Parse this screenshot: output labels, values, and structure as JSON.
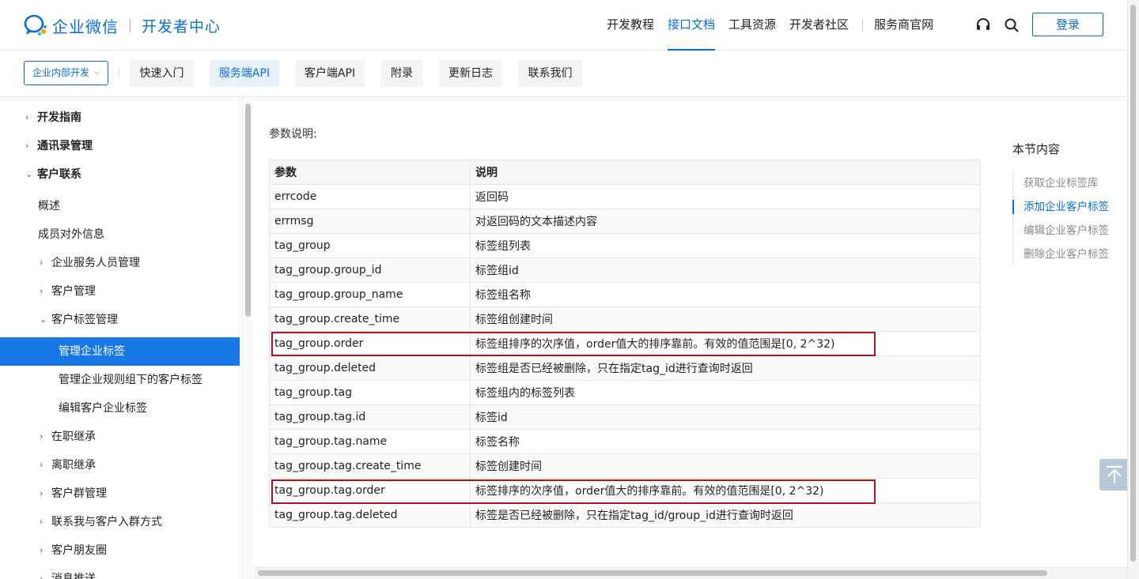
{
  "header": {
    "brand": "企业微信",
    "subtitle": "开发者中心",
    "nav": [
      "开发教程",
      "接口文档",
      "工具资源",
      "开发者社区",
      "服务商官网"
    ],
    "active_nav": 1,
    "login_label": "登录",
    "icons": [
      "headset-icon",
      "search-icon"
    ]
  },
  "subnav": {
    "scope_label": "企业内部开发",
    "tabs": [
      "快速入门",
      "服务端API",
      "客户端API",
      "附录",
      "更新日志",
      "联系我们"
    ],
    "active_tab": 1
  },
  "sidebar": {
    "items": [
      {
        "label": "开发指南",
        "arrow": "›",
        "level": 0
      },
      {
        "label": "通讯录管理",
        "arrow": "›",
        "level": 0
      },
      {
        "label": "客户联系",
        "arrow": "⌄",
        "level": 0
      },
      {
        "label": "概述",
        "arrow": "",
        "level": 1
      },
      {
        "label": "成员对外信息",
        "arrow": "",
        "level": 1
      },
      {
        "label": "企业服务人员管理",
        "arrow": "›",
        "level": 1
      },
      {
        "label": "客户管理",
        "arrow": "›",
        "level": 1
      },
      {
        "label": "客户标签管理",
        "arrow": "⌄",
        "level": 1
      },
      {
        "label": "管理企业标签",
        "arrow": "",
        "level": 2,
        "active": true
      },
      {
        "label": "管理企业规则组下的客户标签",
        "arrow": "",
        "level": 2
      },
      {
        "label": "编辑客户企业标签",
        "arrow": "",
        "level": 2
      },
      {
        "label": "在职继承",
        "arrow": "›",
        "level": 1
      },
      {
        "label": "离职继承",
        "arrow": "›",
        "level": 1
      },
      {
        "label": "客户群管理",
        "arrow": "›",
        "level": 1
      },
      {
        "label": "联系我与客户入群方式",
        "arrow": "›",
        "level": 1
      },
      {
        "label": "客户朋友圈",
        "arrow": "›",
        "level": 1
      },
      {
        "label": "消息推送",
        "arrow": "›",
        "level": 1
      }
    ]
  },
  "main": {
    "section_label": "参数说明:",
    "table": {
      "headers": [
        "参数",
        "说明"
      ],
      "rows": [
        [
          "errcode",
          "返回码"
        ],
        [
          "errmsg",
          "对返回码的文本描述内容"
        ],
        [
          "tag_group",
          "标签组列表"
        ],
        [
          "tag_group.group_id",
          "标签组id"
        ],
        [
          "tag_group.group_name",
          "标签组名称"
        ],
        [
          "tag_group.create_time",
          "标签组创建时间"
        ],
        [
          "tag_group.order",
          "标签组排序的次序值，order值大的排序靠前。有效的值范围是[0, 2^32)"
        ],
        [
          "tag_group.deleted",
          "标签组是否已经被删除，只在指定tag_id进行查询时返回"
        ],
        [
          "tag_group.tag",
          "标签组内的标签列表"
        ],
        [
          "tag_group.tag.id",
          "标签id"
        ],
        [
          "tag_group.tag.name",
          "标签名称"
        ],
        [
          "tag_group.tag.create_time",
          "标签创建时间"
        ],
        [
          "tag_group.tag.order",
          "标签排序的次序值，order值大的排序靠前。有效的值范围是[0, 2^32)"
        ],
        [
          "tag_group.tag.deleted",
          "标签是否已经被删除，只在指定tag_id/group_id进行查询时返回"
        ]
      ]
    },
    "highlight_color": "#b4121a"
  },
  "toc": {
    "title": "本节内容",
    "items": [
      "获取企业标签库",
      "添加企业客户标签",
      "编辑企业客户标签",
      "删除企业客户标签"
    ],
    "active": 1
  },
  "colors": {
    "brand": "#0b6cd6",
    "sidebar_active": "#1677e5"
  }
}
